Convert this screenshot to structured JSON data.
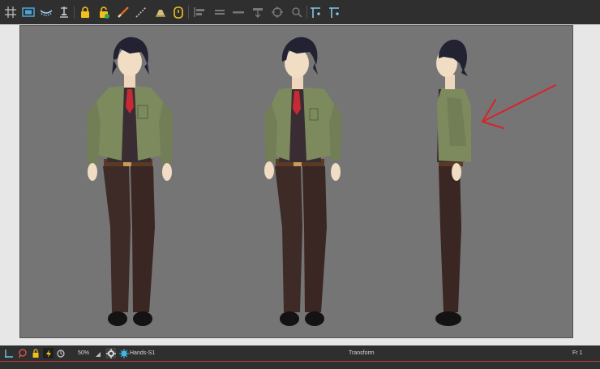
{
  "toolbar": {
    "tools": [
      {
        "name": "grid-icon",
        "accent": "#bfbfbf"
      },
      {
        "name": "safe-area-icon",
        "accent": "#4ea6d8"
      },
      {
        "name": "onion-skin-icon",
        "accent": "#9ed0ef"
      },
      {
        "name": "pivot-icon",
        "accent": "#bfbfbf"
      },
      {
        "name": "lock-icon",
        "accent": "#f2c01e"
      },
      {
        "name": "unlock-icon",
        "accent": "#f2c01e"
      },
      {
        "name": "brush-icon",
        "accent": "#e06a2a"
      },
      {
        "name": "line-icon",
        "accent": "#c0c0c0"
      },
      {
        "name": "light-table-icon",
        "accent": "#d4c07a"
      },
      {
        "name": "stopwatch-icon",
        "accent": "#f2c01e"
      },
      {
        "name": "align-left-icon",
        "accent": "#777777"
      },
      {
        "name": "align-center-icon",
        "accent": "#777777"
      },
      {
        "name": "align-right-icon",
        "accent": "#777777"
      },
      {
        "name": "flip-icon",
        "accent": "#777777"
      },
      {
        "name": "rotate-icon",
        "accent": "#777777"
      },
      {
        "name": "zoom-icon",
        "accent": "#777777"
      },
      {
        "name": "guide-add-icon",
        "accent": "#7fc7e6"
      },
      {
        "name": "guide-add-2-icon",
        "accent": "#7fc7e6"
      }
    ]
  },
  "status": {
    "zoom": "50%",
    "layer": "Hands-S1",
    "tool": "Transform",
    "frame": "Fr 1"
  },
  "colors": {
    "stage": "#757575",
    "jacket": "#7d8a5e",
    "shirt": "#3a2c33",
    "pants": "#3e2a26",
    "hair": "#222233",
    "skin": "#f1dcc4",
    "tie": "#c62a34",
    "arrow": "#d8232a"
  }
}
